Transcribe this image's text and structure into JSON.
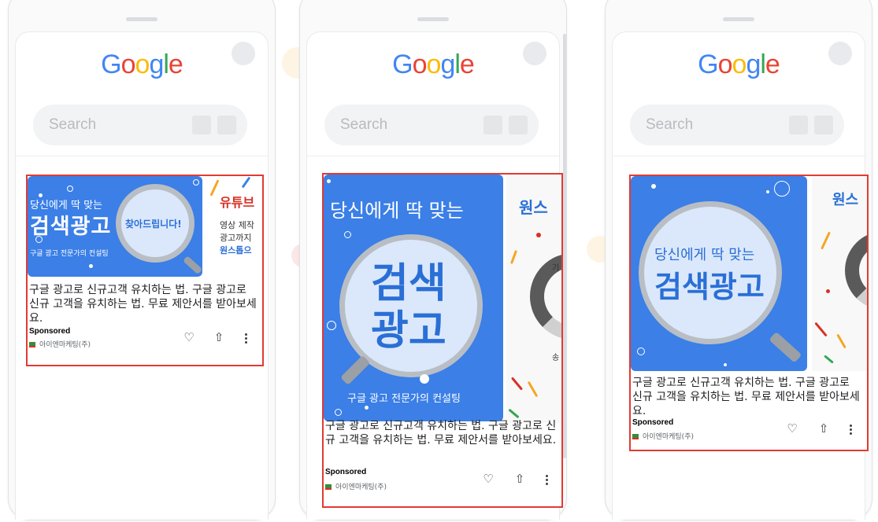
{
  "logo": [
    "G",
    "o",
    "o",
    "g",
    "l",
    "e"
  ],
  "logo_colors": [
    "#4285F4",
    "#EA4335",
    "#FBBC05",
    "#4285F4",
    "#34A853",
    "#EA4335"
  ],
  "search_placeholder": "Search",
  "creative": {
    "headline_small": "당신에게 딱 맞는",
    "headline_big": "검색광고",
    "headline_big_line1": "검색",
    "headline_big_line2": "광고",
    "badge": "찾아드립니다!",
    "caption": "구글 광고 전문가의 컨설팅",
    "second_title_1": "유튜브",
    "second_title_2": "원스",
    "second_lines": [
      "영상 제작",
      "광고까지",
      "원스톱으"
    ],
    "second_partial_1": "기",
    "second_partial_2": "송"
  },
  "ad": {
    "description": "구글 광고로 신규고객 유치하는 법. 구글 광고로 신규 고객을 유치하는 법. 무료 제안서를 받아보세요.",
    "sponsored": "Sponsored",
    "advertiser": "아이엔마케팅(주)",
    "actions": [
      "heart-icon",
      "share-icon",
      "more-icon"
    ],
    "heart_glyph": "♡",
    "share_glyph": "⇧"
  },
  "colors": {
    "highlight": "#e23a33",
    "creative_blue": "#3b7fe7"
  }
}
